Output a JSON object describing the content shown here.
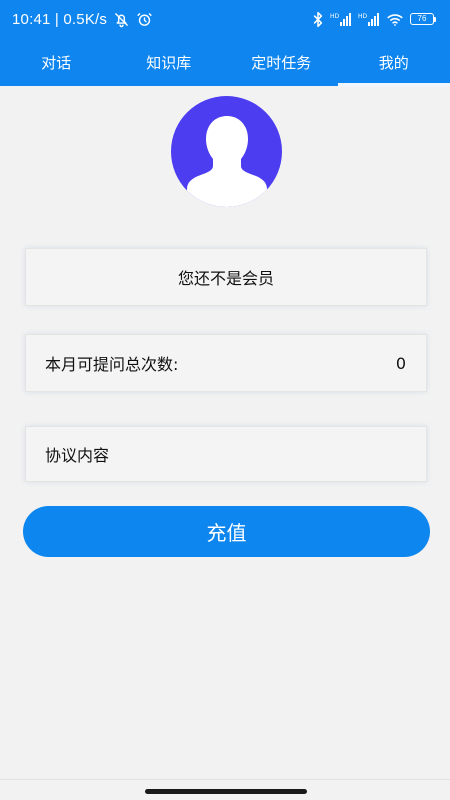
{
  "status_bar": {
    "time_speed": "10:41 | 0.5K/s",
    "battery": "76",
    "icons": [
      "notifications-off-icon",
      "alarm-icon",
      "bluetooth-icon",
      "signal-hd-1-icon",
      "signal-hd-2-icon",
      "wifi-icon",
      "battery-icon"
    ]
  },
  "tabs": [
    {
      "label": "对话",
      "active": false
    },
    {
      "label": "知识库",
      "active": false
    },
    {
      "label": "定时任务",
      "active": false
    },
    {
      "label": "我的",
      "active": true
    }
  ],
  "profile": {
    "avatar_icon": "user-avatar-icon",
    "member_status": "您还不是会员",
    "quota_label": "本月可提问总次数:",
    "quota_value": "0",
    "agreement_label": "协议内容",
    "recharge_label": "充值"
  },
  "colors": {
    "primary": "#0f86ef",
    "avatar": "#4d3df0",
    "background": "#f2f2f2"
  }
}
